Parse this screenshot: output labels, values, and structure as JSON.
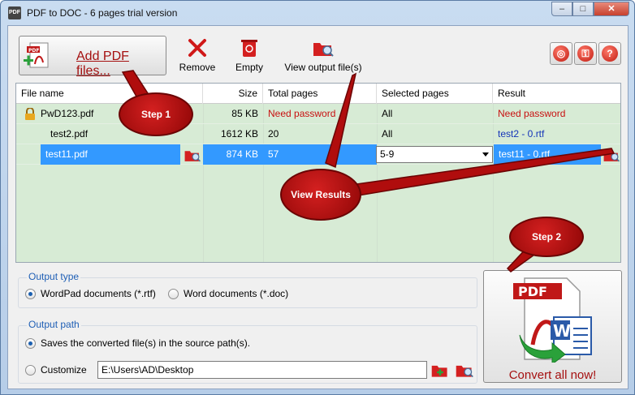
{
  "window": {
    "title": "PDF to DOC - 6 pages trial version",
    "icon_text": "PDF"
  },
  "toolbar": {
    "add_label": "Add PDF files...",
    "remove_label": "Remove",
    "empty_label": "Empty",
    "view_output_label": "View output file(s)"
  },
  "grid": {
    "columns": [
      "File name",
      "Size",
      "Total pages",
      "Selected pages",
      "Result"
    ],
    "rows": [
      {
        "name": "PwD123.pdf",
        "size": "85 KB",
        "total": "Need password",
        "selected": "All",
        "result": "Need password"
      },
      {
        "name": "test2.pdf",
        "size": "1612 KB",
        "total": "20",
        "selected": "All",
        "result": "test2 - 0.rtf"
      },
      {
        "name": "test11.pdf",
        "size": "874 KB",
        "total": "57",
        "selected": "5-9",
        "result": "test11 - 0.rtf"
      }
    ]
  },
  "output_type": {
    "title": "Output type",
    "wordpad": "WordPad documents (*.rtf)",
    "word": "Word documents (*.doc)"
  },
  "output_path": {
    "title": "Output path",
    "source": "Saves the converted file(s) in the source path(s).",
    "customize": "Customize",
    "path_value": "E:\\Users\\AD\\Desktop"
  },
  "convert": {
    "label": "Convert all now!",
    "icon_pdf": "PDF",
    "icon_w": "W"
  },
  "callouts": {
    "step1": "Step 1",
    "step2": "Step 2",
    "view_results": "View Results"
  },
  "colors": {
    "accent_red": "#a51010",
    "grid_bg": "#d7ebd5",
    "selection": "#3399ff",
    "link_blue": "#1535b8"
  }
}
